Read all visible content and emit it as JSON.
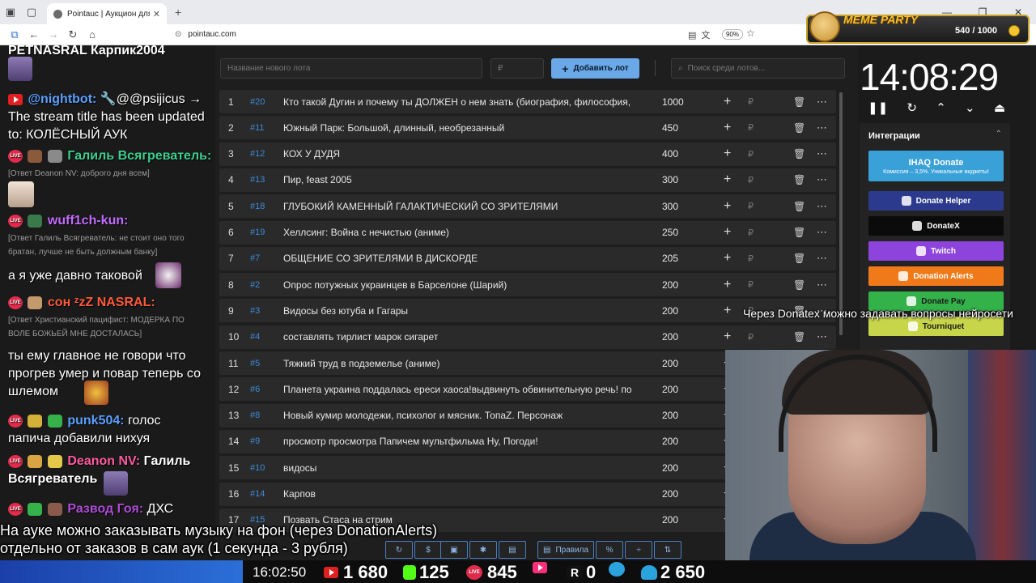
{
  "browser": {
    "tab_title": "Pointauc | Аукцион для стримера",
    "url": "pointauc.com",
    "zoom": "90%"
  },
  "meme_party": {
    "title": "MEME PARTY",
    "count": "540 / 1000"
  },
  "chat": {
    "messages": [
      {
        "nick": "PETNASRAL Карпик2004",
        "text": ""
      },
      {
        "nick": "@nightbot:",
        "text": "🔧@@psijicus → The stream title has been updated to: КОЛЁСНЫЙ АУК"
      },
      {
        "nick": "Галиль Всягреватель:",
        "text": ""
      },
      {
        "reply": "[Ответ Deanon NV: доброго дня всем]"
      },
      {
        "nick": "wuff1ch-kun:",
        "text": ""
      },
      {
        "reply": "[Ответ Галиль Всягреватель: не стоит оно того братан, лучше не быть должным банку]"
      },
      {
        "text": "а я уже давно таковой"
      },
      {
        "nick": "сон ᶻzZ NASRAL:",
        "text": ""
      },
      {
        "reply": "[Ответ Христианский пацифист: МОДЕРКА ПО ВОЛЕ БОЖЬЕЙ МНЕ ДОСТАЛАСЬ]"
      },
      {
        "text": "ты ему главное не говори что прогрев умер и повар теперь со шлемом"
      },
      {
        "nick": "punk504:",
        "text": "голос папича добавили нихуя"
      },
      {
        "nick": "Deanon NV:",
        "text": "Галиль Всягреватель"
      },
      {
        "nick": "Развод Гоя:",
        "text": "ДХС"
      }
    ]
  },
  "auction": {
    "new_lot_placeholder": "Название нового лота",
    "price_placeholder": "₽",
    "add_button": "Добавить лот",
    "search_placeholder": "Поиск среди лотов...",
    "lots": [
      {
        "n": "1",
        "id": "#20",
        "name": "Кто такой Дугин и почему ты ДОЛЖЕН о нем знать (биография, философия,",
        "amount": "1000"
      },
      {
        "n": "2",
        "id": "#11",
        "name": "Южный Парк: Большой, длинный, необрезанный",
        "amount": "450"
      },
      {
        "n": "3",
        "id": "#12",
        "name": "КОХ У ДУДЯ",
        "amount": "400"
      },
      {
        "n": "4",
        "id": "#13",
        "name": "Пир, feast 2005",
        "amount": "300"
      },
      {
        "n": "5",
        "id": "#18",
        "name": "ГЛУБОКИЙ КАМЕННЫЙ ГАЛАКТИЧЕСКИЙ СО ЗРИТЕЛЯМИ",
        "amount": "300"
      },
      {
        "n": "6",
        "id": "#19",
        "name": "Хеллсинг: Война с нечистью (аниме)",
        "amount": "250"
      },
      {
        "n": "7",
        "id": "#7",
        "name": "ОБЩЕНИЕ СО ЗРИТЕЛЯМИ В ДИСКОРДЕ",
        "amount": "205"
      },
      {
        "n": "8",
        "id": "#2",
        "name": "Опрос потужных украинцев в Барселоне (Шарий)",
        "amount": "200"
      },
      {
        "n": "9",
        "id": "#3",
        "name": "Видосы без ютуба и Гагары",
        "amount": "200"
      },
      {
        "n": "10",
        "id": "#4",
        "name": "составлять тирлист марок сигарет",
        "amount": "200"
      },
      {
        "n": "11",
        "id": "#5",
        "name": "Тяжкий труд в подземелье (аниме)",
        "amount": "200"
      },
      {
        "n": "12",
        "id": "#6",
        "name": "Планета украина поддалась ереси хаоса!выдвинуть обвинительную речь! по",
        "amount": "200"
      },
      {
        "n": "13",
        "id": "#8",
        "name": "Новый кумир молодежи, психолог и мясник. ТопаZ. Персонаж",
        "amount": "200"
      },
      {
        "n": "14",
        "id": "#9",
        "name": "просмотр просмотра Папичем мультфильма Ну, Погоди!",
        "amount": "200"
      },
      {
        "n": "15",
        "id": "#10",
        "name": "видосы",
        "amount": "200"
      },
      {
        "n": "16",
        "id": "#14",
        "name": "Карпов",
        "amount": "200"
      },
      {
        "n": "17",
        "id": "#15",
        "name": "Позвать Стаса на стрим",
        "amount": "200"
      }
    ],
    "rules_button": "Правила"
  },
  "timer": {
    "value": "14:08:29"
  },
  "integrations": {
    "title": "Интеграции",
    "ihaq": {
      "label": "IHAQ Donate",
      "sub": "Комиссия – 3,5%. Уникальные виджеты!"
    },
    "buttons": [
      {
        "label": "Donate Helper",
        "color": "#2b3a8c"
      },
      {
        "label": "DonateX",
        "color": "#0b0b0b"
      },
      {
        "label": "Twitch",
        "color": "#8d44dd"
      },
      {
        "label": "Donation Alerts",
        "color": "#f07a1a"
      },
      {
        "label": "Donate Pay",
        "color": "#34b24a"
      },
      {
        "label": "Tourniquet",
        "color": "#c7d54a"
      }
    ]
  },
  "overlay": {
    "ticker": "Через Donatex можно задавать вопросы нейросети",
    "bottom_line1": "На ауке можно заказывать музыку на фон (через DonationAlerts)",
    "bottom_line2": "отдельно от заказов в сам аук (1 секунда - 3 рубля)",
    "clock": "16:02:50",
    "stats": [
      {
        "platform": "youtube-icon",
        "value": "1 680"
      },
      {
        "platform": "kick-icon",
        "value": "125"
      },
      {
        "platform": "vklive-icon",
        "value": "845"
      },
      {
        "platform": "youtube-icon",
        "value": ""
      },
      {
        "platform": "rutube-icon",
        "value": "0"
      },
      {
        "platform": "telegram-icon",
        "value": ""
      },
      {
        "platform": "viewers-icon",
        "value": "2 650"
      }
    ]
  }
}
